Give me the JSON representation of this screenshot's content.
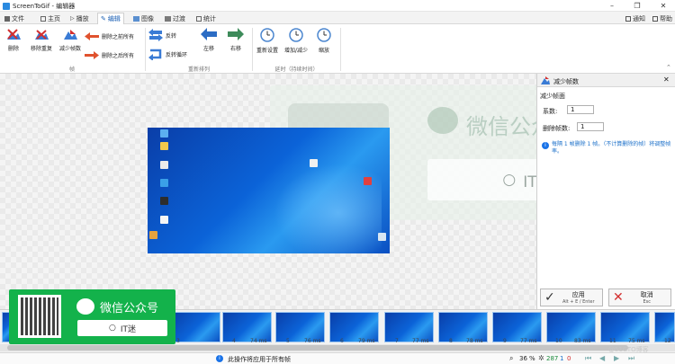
{
  "window": {
    "title": "ScreenToGif - 编辑器"
  },
  "tabs": [
    {
      "label": "文件"
    },
    {
      "label": "主页"
    },
    {
      "label": "播放"
    },
    {
      "label": "编辑"
    },
    {
      "label": "图像"
    },
    {
      "label": "过渡"
    },
    {
      "label": "统计"
    }
  ],
  "top_right": {
    "notify": "通知",
    "help": "帮助"
  },
  "ribbon": {
    "delete": "删除",
    "remove_dup": "移除重复",
    "reduce": "减少帧数",
    "delete_prev": "删除之前所有",
    "delete_next": "删除之后所有",
    "frames_group": "帧",
    "reverse": "反转",
    "yoyo": "反转循环",
    "move_left": "左移",
    "move_right": "右移",
    "reorder_group": "重新排列",
    "override_delay": "重新设置",
    "inc_dec_delay": "增加/减少",
    "scale_delay": "缩放",
    "delay_group": "延时（持续时间）"
  },
  "panel": {
    "header": "减少帧数",
    "section": "减少帧面",
    "factor_label": "系数:",
    "factor_value": "1",
    "remove_label": "删除帧数:",
    "remove_value": "1",
    "info": "每隔 1 帧删除 1 帧。（不计算删除的帧）将调整帧率。",
    "apply_label": "应用",
    "apply_shortcut": "Alt + E / Enter",
    "cancel_label": "取消",
    "cancel_shortcut": "Esc"
  },
  "watermark": {
    "brand": "微信公众号",
    "search": "IT迷"
  },
  "promo": {
    "brand": "微信公众号",
    "search": "IT迷"
  },
  "frames": [
    {
      "index": "3",
      "delay": "80 ms"
    },
    {
      "index": "4",
      "delay": "74 ms"
    },
    {
      "index": "5",
      "delay": "76 ms"
    },
    {
      "index": "6",
      "delay": "79 ms"
    },
    {
      "index": "7",
      "delay": "77 ms"
    },
    {
      "index": "8",
      "delay": "78 ms"
    },
    {
      "index": "9",
      "delay": "77 ms"
    },
    {
      "index": "10",
      "delay": "83 ms"
    },
    {
      "index": "11",
      "delay": "75 ms"
    },
    {
      "index": "12",
      "delay": ""
    }
  ],
  "status": {
    "message": "此操作将应用于所有帧",
    "zoom": "36",
    "zoom_unit": "%",
    "total_frames": "287",
    "selected": "1",
    "current": "0",
    "blog": "@51CTO博客"
  },
  "colors": {
    "accent": "#1a5fb4",
    "promo_green": "#13b24b",
    "desktop_blue": "#0b63d8"
  }
}
